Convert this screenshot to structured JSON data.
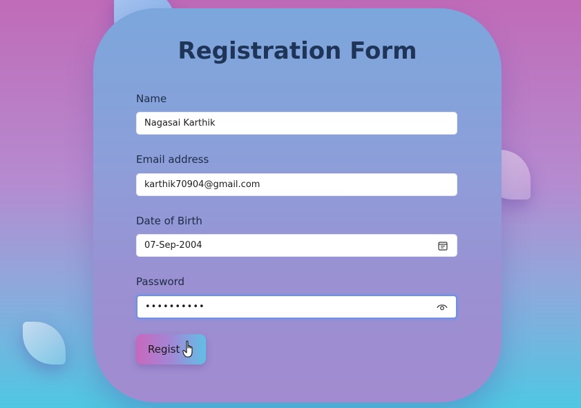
{
  "form": {
    "title": "Registration Form",
    "fields": [
      {
        "label": "Name",
        "value": "Nagasai Karthik"
      },
      {
        "label": "Email address",
        "value": "karthik70904@gmail.com"
      },
      {
        "label": "Date of Birth",
        "value": "07-Sep-2004",
        "icon": "calendar-icon"
      },
      {
        "label": "Password",
        "value": "••••••••••",
        "icon": "eye-icon"
      }
    ],
    "submit_label": "Regist"
  }
}
